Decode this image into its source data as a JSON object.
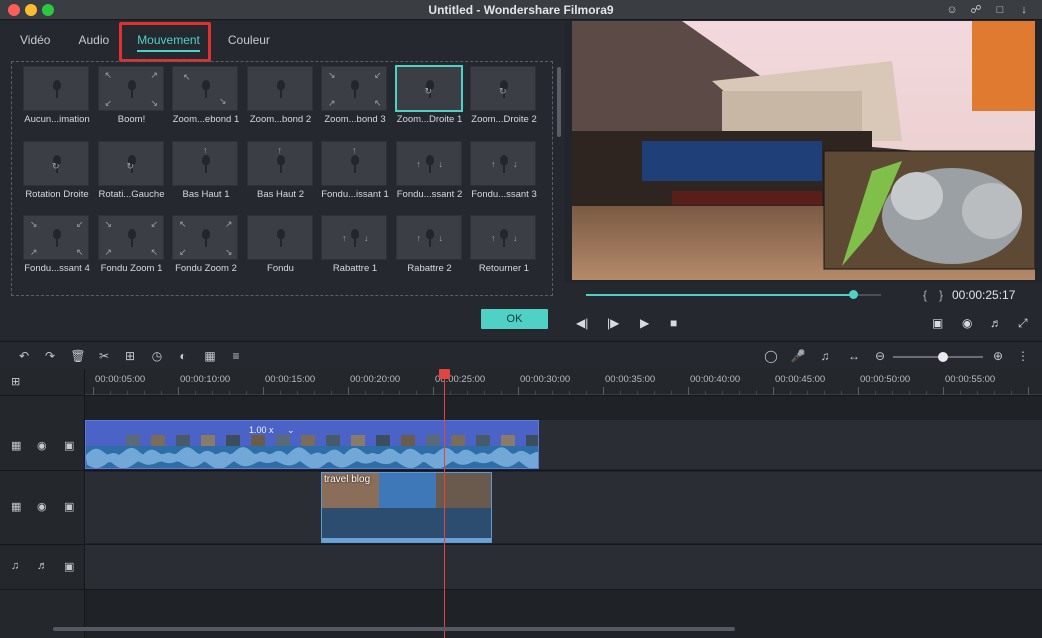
{
  "window": {
    "title": "Untitled - Wondershare Filmora9",
    "toolbar_icons": [
      "account-icon",
      "cart-icon",
      "gift-icon",
      "download-icon"
    ]
  },
  "media_panel": {
    "tabs": [
      {
        "label": "Vidéo",
        "active": false
      },
      {
        "label": "Audio",
        "active": false
      },
      {
        "label": "Mouvement",
        "active": true
      },
      {
        "label": "Couleur",
        "active": false
      }
    ],
    "items": [
      {
        "label": "Aucun...imation",
        "arrows": ""
      },
      {
        "label": "Boom!",
        "arrows": "corners-out"
      },
      {
        "label": "Zoom...ebond 1",
        "arrows": "diag"
      },
      {
        "label": "Zoom...bond 2",
        "arrows": "frame"
      },
      {
        "label": "Zoom...bond 3",
        "arrows": "corners-in"
      },
      {
        "label": "Zoom...Droite 1",
        "arrows": "rotate",
        "selected": true
      },
      {
        "label": "Zoom...Droite 2",
        "arrows": "rotate"
      },
      {
        "label": "Rotation Droite",
        "arrows": "rotate"
      },
      {
        "label": "Rotati...Gauche",
        "arrows": "rotate"
      },
      {
        "label": "Bas Haut 1",
        "arrows": "up"
      },
      {
        "label": "Bas Haut 2",
        "arrows": "up"
      },
      {
        "label": "Fondu...issant 1",
        "arrows": "up"
      },
      {
        "label": "Fondu...ssant 2",
        "arrows": "updown"
      },
      {
        "label": "Fondu...ssant 3",
        "arrows": "updown"
      },
      {
        "label": "Fondu...ssant 4",
        "arrows": "corners-in"
      },
      {
        "label": "Fondu Zoom 1",
        "arrows": "corners-in"
      },
      {
        "label": "Fondu Zoom 2",
        "arrows": "corners-out"
      },
      {
        "label": "Fondu",
        "arrows": ""
      },
      {
        "label": "Rabattre 1",
        "arrows": "updown"
      },
      {
        "label": "Rabattre 2",
        "arrows": "updown"
      },
      {
        "label": "Retourner 1",
        "arrows": "updown"
      }
    ],
    "ok_label": "OK"
  },
  "player": {
    "timecode": "00:00:25:17",
    "progress": 0.905,
    "controls": [
      "step-back-icon",
      "play-frame-icon",
      "play-icon",
      "stop-icon"
    ],
    "right_controls": [
      "display-settings-icon",
      "snapshot-icon",
      "volume-icon",
      "fullscreen-icon"
    ]
  },
  "timeline": {
    "ruler_labels": [
      "00:00:05:00",
      "00:00:10:00",
      "00:00:15:00",
      "00:00:20:00",
      "00:00:25:00",
      "00:00:30:00",
      "00:00:35:00",
      "00:00:40:00",
      "00:00:45:00",
      "00:00:50:00",
      "00:00:55:00"
    ],
    "clip1_speed": "1.00 x",
    "clip2_title": "travel blog",
    "zoom_level": 0.55
  },
  "colors": {
    "accent": "#4fd1c5",
    "highlight": "#e0312f",
    "playhead": "#e0453f",
    "clip_video": "#4b63c7",
    "clip_pip": "#2c4d70"
  }
}
